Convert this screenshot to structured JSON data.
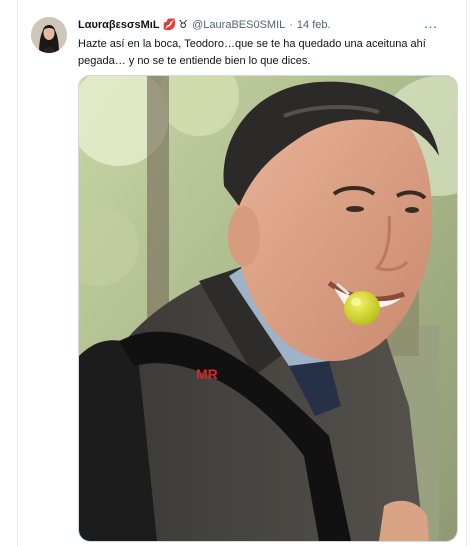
{
  "tweet": {
    "display_name": "LαυrαβεsσsMιL",
    "name_emoji": "💋",
    "zodiac_symbol": "♉",
    "handle": "@LauraBES0SMIL",
    "separator": "·",
    "date": "14 feb.",
    "more_icon": "…",
    "text": "Hazte así en la boca, Teodoro…que se te ha quedado una aceituna ahí pegada… y no se te entiende bien lo que dices.",
    "media": {
      "type": "photo",
      "watermark": "MR",
      "icon": "photo-man-with-olive"
    }
  },
  "colors": {
    "text_primary": "#0f1419",
    "text_secondary": "#536471",
    "border": "#cfd9de",
    "watermark": "#d8262c",
    "olive": "#c9d21e"
  }
}
